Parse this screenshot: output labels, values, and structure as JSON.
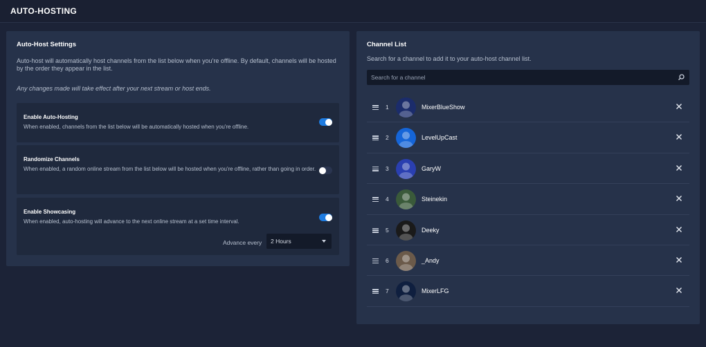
{
  "header": {
    "title": "AUTO-HOSTING"
  },
  "settings": {
    "heading": "Auto-Host Settings",
    "description": "Auto-host will automatically host channels from the list below when you're offline. By default, channels will be hosted by the order they appear in the list.",
    "note": "Any changes made will take effect after your next stream or host ends.",
    "enable_auto_hosting": {
      "title": "Enable Auto-Hosting",
      "desc": "When enabled, channels from the list below will be automatically hosted when you're offline.",
      "enabled": true
    },
    "randomize": {
      "title": "Randomize Channels",
      "desc": "When enabled, a random online stream from the list below will be hosted when you're offline, rather than going in order.",
      "enabled": false
    },
    "showcasing": {
      "title": "Enable Showcasing",
      "desc": "When enabled, auto-hosting will advance to the next online stream at a set time interval.",
      "enabled": true,
      "advance_label": "Advance every",
      "advance_value": "2 Hours"
    }
  },
  "channels": {
    "heading": "Channel List",
    "description": "Search for a channel to add it to your auto-host channel list.",
    "search_placeholder": "Search for a channel",
    "items": [
      {
        "rank": "1",
        "name": "MixerBlueShow",
        "avatar_color": "#1b2c6b"
      },
      {
        "rank": "2",
        "name": "LevelUpCast",
        "avatar_color": "#1565d8"
      },
      {
        "rank": "3",
        "name": "GaryW",
        "avatar_color": "#2a3fb0"
      },
      {
        "rank": "4",
        "name": "Steinekin",
        "avatar_color": "#3a5a3a"
      },
      {
        "rank": "5",
        "name": "Deeky",
        "avatar_color": "#1a1a1a"
      },
      {
        "rank": "6",
        "name": "_Andy",
        "avatar_color": "#6b5a4a"
      },
      {
        "rank": "7",
        "name": "MixerLFG",
        "avatar_color": "#0f1f3f"
      }
    ]
  },
  "colors": {
    "background": "#1c2337",
    "panel": "#26324a",
    "accent": "#1e7be0"
  }
}
